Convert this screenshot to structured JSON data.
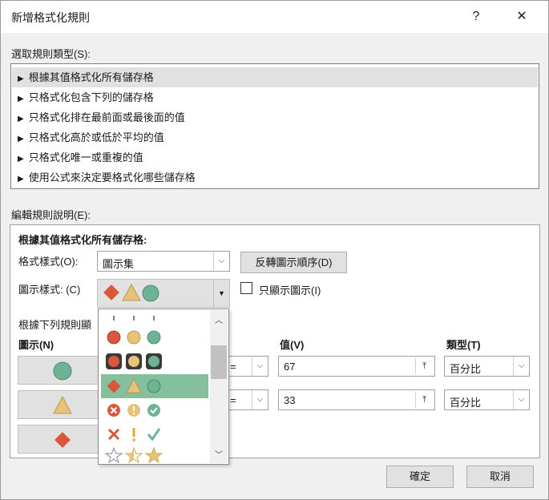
{
  "window": {
    "title": "新增格式化規則",
    "help_label": "?",
    "close_label": "✕"
  },
  "rule_type": {
    "label": "選取規則類型(S):",
    "items": [
      "根據其值格式化所有儲存格",
      "只格式化包含下列的儲存格",
      "只格式化排在最前面或最後面的值",
      "只格式化高於或低於平均的值",
      "只格式化唯一或重複的值",
      "使用公式來決定要格式化哪些儲存格"
    ],
    "selected_index": 0
  },
  "edit": {
    "label": "編輯規則說明(E):",
    "heading": "根據其值格式化所有儲存格:",
    "format_style_label": "格式樣式(O):",
    "format_style_value": "圖示集",
    "reverse_button": "反轉圖示順序(D)",
    "icon_style_label": "圖示樣式: (C)",
    "show_icon_only_label": "只顯示圖示(I)",
    "show_icon_only_checked": false,
    "rules_caption": "根據下列規則顯",
    "col_icon": "圖示(N)",
    "col_value": "值(V)",
    "col_type": "類型(T)",
    "rows": [
      {
        "icon": "green-circle-icon",
        "operator": ">=",
        "value": "67",
        "type": "百分比"
      },
      {
        "icon": "yellow-triangle-icon",
        "operator": ">=",
        "value": "33",
        "type": "百分比"
      },
      {
        "icon": "red-diamond-icon"
      }
    ]
  },
  "icon_dropdown": {
    "options": [
      "partial-row-icon",
      "three-traffic-lights-unrimmed-icon",
      "three-traffic-lights-rimmed-icon",
      "three-signs-icon",
      "three-symbols-circled-icon",
      "three-symbols-uncircled-icon",
      "three-stars-icon"
    ],
    "selected_index": 3
  },
  "footer": {
    "ok_label": "確定",
    "cancel_label": "取消"
  },
  "colors": {
    "red": "#d9573a",
    "yellow": "#e9c27a",
    "green": "#6db396",
    "selected_bg": "#86bf9b"
  }
}
